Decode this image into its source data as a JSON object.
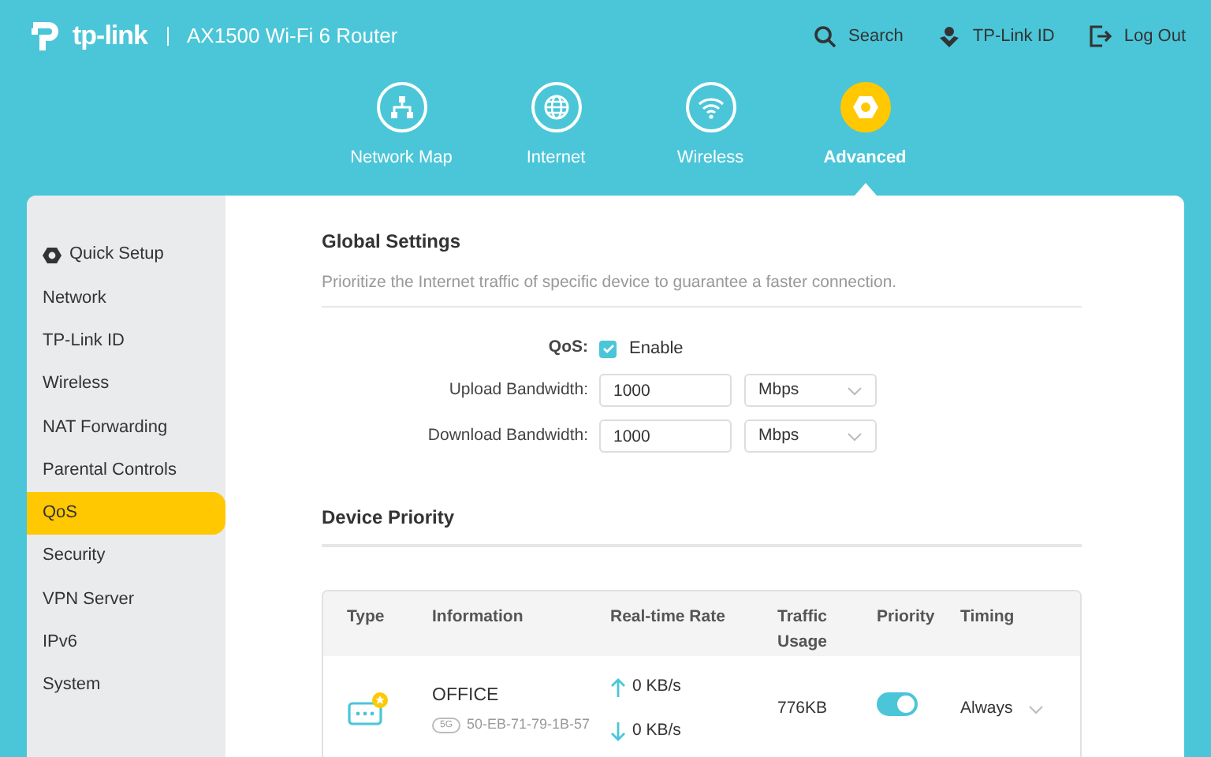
{
  "header": {
    "logo": "tp-link",
    "model": "AX1500 Wi-Fi 6 Router",
    "actions": [
      {
        "kind": "search",
        "label": "Search"
      },
      {
        "kind": "id",
        "label": "TP-Link ID"
      },
      {
        "kind": "logout",
        "label": "Log Out"
      }
    ]
  },
  "main_nav": [
    {
      "kind": "map",
      "label": "Network Map",
      "selected": false
    },
    {
      "kind": "globe",
      "label": "Internet",
      "selected": false
    },
    {
      "kind": "wifi",
      "label": "Wireless",
      "selected": false
    },
    {
      "kind": "gear",
      "label": "Advanced",
      "selected": true
    }
  ],
  "sidebar": {
    "items": [
      {
        "kind": "setup",
        "label": "Quick Setup",
        "selected": false
      },
      {
        "label": "Network",
        "selected": false
      },
      {
        "label": "TP-Link ID",
        "selected": false
      },
      {
        "label": "Wireless",
        "selected": false
      },
      {
        "label": "NAT Forwarding",
        "selected": false
      },
      {
        "label": "Parental Controls",
        "selected": false
      },
      {
        "label": "QoS",
        "selected": true
      },
      {
        "label": "Security",
        "selected": false
      },
      {
        "label": "VPN Server",
        "selected": false
      },
      {
        "label": "IPv6",
        "selected": false
      },
      {
        "label": "System",
        "selected": false
      }
    ]
  },
  "global_settings": {
    "title": "Global Settings",
    "description": "Prioritize the Internet traffic of specific device to guarantee a faster connection.",
    "qos": {
      "label": "QoS:",
      "option": "Enable",
      "checked": true
    },
    "fields": [
      {
        "label": "Upload Bandwidth:",
        "value": "1000",
        "unit": "Mbps"
      },
      {
        "label": "Download Bandwidth:",
        "value": "1000",
        "unit": "Mbps"
      }
    ]
  },
  "device_priority": {
    "title": "Device Priority",
    "table": {
      "columns": [
        "Type",
        "Information",
        "Real-time Rate",
        "Traffic Usage",
        "Priority",
        "Timing"
      ],
      "rows": [
        {
          "name": "OFFICE",
          "band": "5G",
          "mac": "50-EB-71-79-1B-57",
          "upload": "0 KB/s",
          "download": "0 KB/s",
          "traffic": "776KB",
          "priority_on": true,
          "timing": "Always"
        }
      ]
    }
  }
}
